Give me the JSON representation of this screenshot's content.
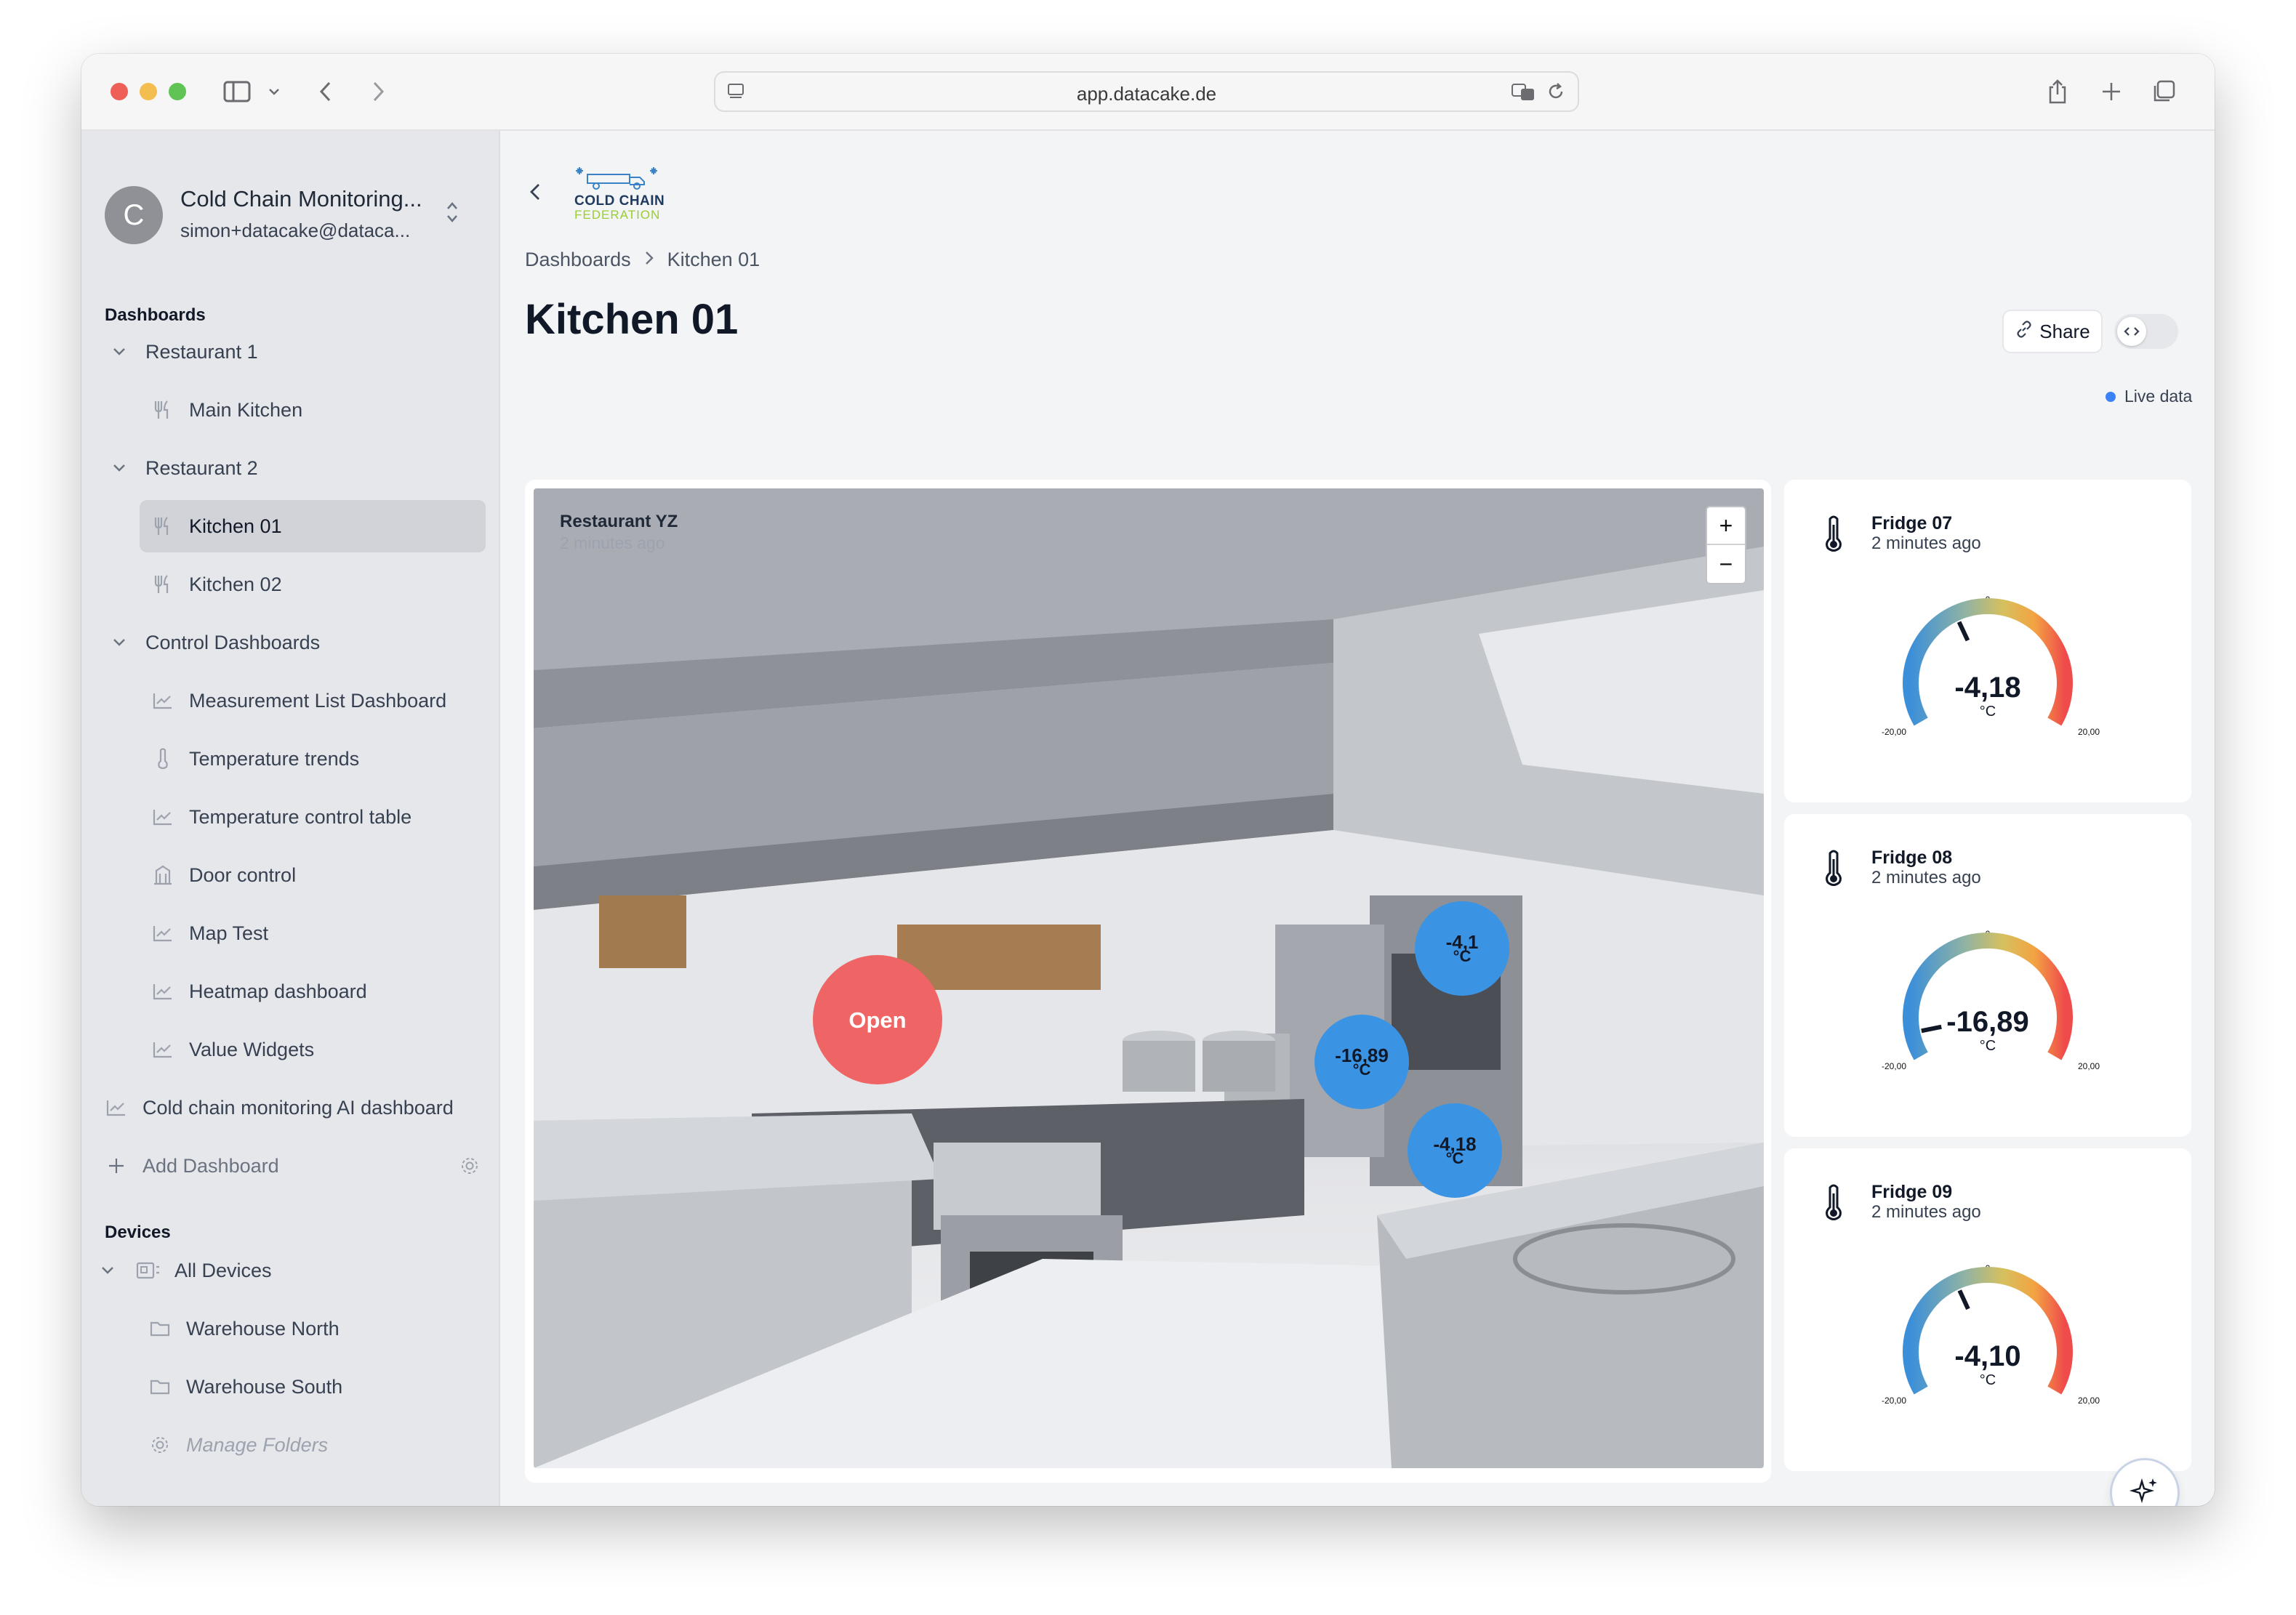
{
  "browser": {
    "url": "app.datacake.de"
  },
  "sidebar": {
    "org_name": "Cold Chain Monitoring...",
    "org_email": "simon+datacake@dataca...",
    "avatar_letter": "C",
    "dashboards_title": "Dashboards",
    "items": [
      {
        "label": "Restaurant 1",
        "type": "folder"
      },
      {
        "label": "Main Kitchen",
        "type": "dashboard",
        "icon": "utensils-icon"
      },
      {
        "label": "Restaurant 2",
        "type": "folder"
      },
      {
        "label": "Kitchen 01",
        "type": "dashboard",
        "icon": "utensils-icon",
        "active": true
      },
      {
        "label": "Kitchen 02",
        "type": "dashboard",
        "icon": "utensils-icon"
      },
      {
        "label": "Control Dashboards",
        "type": "folder"
      },
      {
        "label": "Measurement List Dashboard",
        "type": "dashboard",
        "icon": "chart-icon"
      },
      {
        "label": "Temperature trends",
        "type": "dashboard",
        "icon": "thermometer-icon"
      },
      {
        "label": "Temperature control table",
        "type": "dashboard",
        "icon": "chart-icon"
      },
      {
        "label": "Door control",
        "type": "dashboard",
        "icon": "building-icon"
      },
      {
        "label": "Map Test",
        "type": "dashboard",
        "icon": "chart-icon"
      },
      {
        "label": "Heatmap dashboard",
        "type": "dashboard",
        "icon": "chart-icon"
      },
      {
        "label": "Value Widgets",
        "type": "dashboard",
        "icon": "chart-icon"
      },
      {
        "label": "Cold chain monitoring AI dashboard",
        "type": "dashboard",
        "icon": "chart-icon"
      }
    ],
    "add_dashboard": "Add Dashboard",
    "devices_title": "Devices",
    "all_devices": "All Devices",
    "device_folders": [
      "Warehouse North",
      "Warehouse South"
    ],
    "manage_folders": "Manage Folders"
  },
  "main": {
    "logo_line1": "COLD CHAIN",
    "logo_line2": "FEDERATION",
    "breadcrumb": [
      "Dashboards",
      "Kitchen 01"
    ],
    "title": "Kitchen 01",
    "share_label": "Share",
    "live_label": "Live data",
    "image_widget": {
      "title": "Restaurant YZ",
      "subtitle": "2 minutes ago",
      "markers": [
        {
          "label": "Open",
          "kind": "status"
        },
        {
          "value": "-4,1",
          "unit": "°C"
        },
        {
          "value": "-16,89",
          "unit": "°C"
        },
        {
          "value": "-4,18",
          "unit": "°C"
        }
      ]
    },
    "fridges": [
      {
        "name": "Fridge 07",
        "ago": "2 minutes ago",
        "value": "-4,18",
        "raw": -4.18,
        "unit": "°C",
        "min": "-20,00",
        "max": "20,00",
        "mid": "0"
      },
      {
        "name": "Fridge 08",
        "ago": "2 minutes ago",
        "value": "-16,89",
        "raw": -16.89,
        "unit": "°C",
        "min": "-20,00",
        "max": "20,00",
        "mid": "0"
      },
      {
        "name": "Fridge 09",
        "ago": "2 minutes ago",
        "value": "-4,10",
        "raw": -4.1,
        "unit": "°C",
        "min": "-20,00",
        "max": "20,00",
        "mid": "0"
      }
    ]
  },
  "colors": {
    "marker_blue": "#3b93e4",
    "marker_red": "#ef6464",
    "live_dot": "#3b82f6"
  }
}
